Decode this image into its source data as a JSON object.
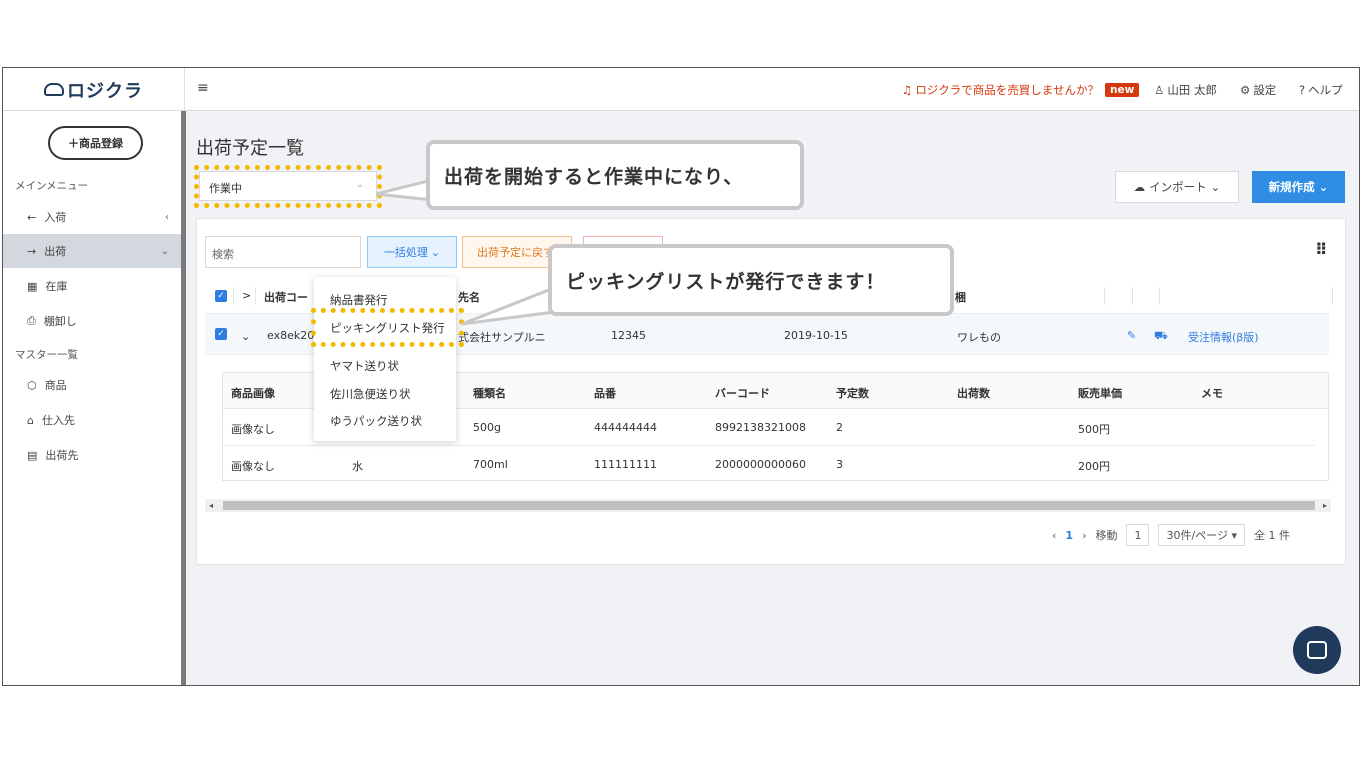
{
  "header": {
    "logo": "ロジクラ",
    "menu_icon": "hamburger-icon",
    "promo_text": "ロジクラで商品を売買しませんか？",
    "promo_badge": "new",
    "user_name": "山田 太郎",
    "settings_label": "設定",
    "help_label": "ヘルプ"
  },
  "sidebar": {
    "add_product_label": "＋商品登録",
    "main_menu_label": "メインメニュー",
    "master_label": "マスター一覧",
    "items": [
      {
        "label": "入荷",
        "icon": "←",
        "caret": "‹"
      },
      {
        "label": "出荷",
        "icon": "→",
        "caret": "⌄"
      },
      {
        "label": "在庫",
        "icon": "▦"
      },
      {
        "label": "棚卸し",
        "icon": "⎙"
      },
      {
        "label": "商品",
        "icon": "⬡"
      },
      {
        "label": "仕入先",
        "icon": "⌂"
      },
      {
        "label": "出荷先",
        "icon": "▤"
      }
    ]
  },
  "main": {
    "title": "出荷予定一覧",
    "status_value": "作業中",
    "import_label": "インポート",
    "new_label": "新規作成",
    "search_placeholder": "検索",
    "bulk_label": "一括処理",
    "return_label": "出荷予定に戻す"
  },
  "callouts": {
    "first": "出荷を開始すると作業中になり、",
    "second": "ピッキングリストが発行できます！"
  },
  "table": {
    "headers": {
      "code": "出荷コー",
      "dest": "先名",
      "memo": "梱"
    },
    "row": {
      "code": "ex8ek201",
      "dest": "式会社サンプルニ",
      "zip": "12345",
      "date": "2019-10-15",
      "memo": "ワレもの",
      "order_info": "受注情報(β版)"
    }
  },
  "subtable": {
    "headers": [
      "商品画像",
      "",
      "種類名",
      "品番",
      "バーコード",
      "予定数",
      "出荷数",
      "販売単価",
      "メモ"
    ],
    "rows": [
      [
        "画像なし",
        "",
        "500g",
        "444444444",
        "8992138321008",
        "2",
        "",
        "500円",
        ""
      ],
      [
        "画像なし",
        "水",
        "700ml",
        "111111111",
        "2000000000060",
        "3",
        "",
        "200円",
        ""
      ]
    ]
  },
  "dropdown": {
    "items": [
      "納品書発行",
      "ピッキングリスト発行",
      "ヤマト送り状",
      "佐川急便送り状",
      "ゆうパック送り状"
    ]
  },
  "pager": {
    "current": "1",
    "goto_label": "移動",
    "goto_value": "1",
    "per_page": "30件/ページ",
    "total": "全 1 件"
  }
}
